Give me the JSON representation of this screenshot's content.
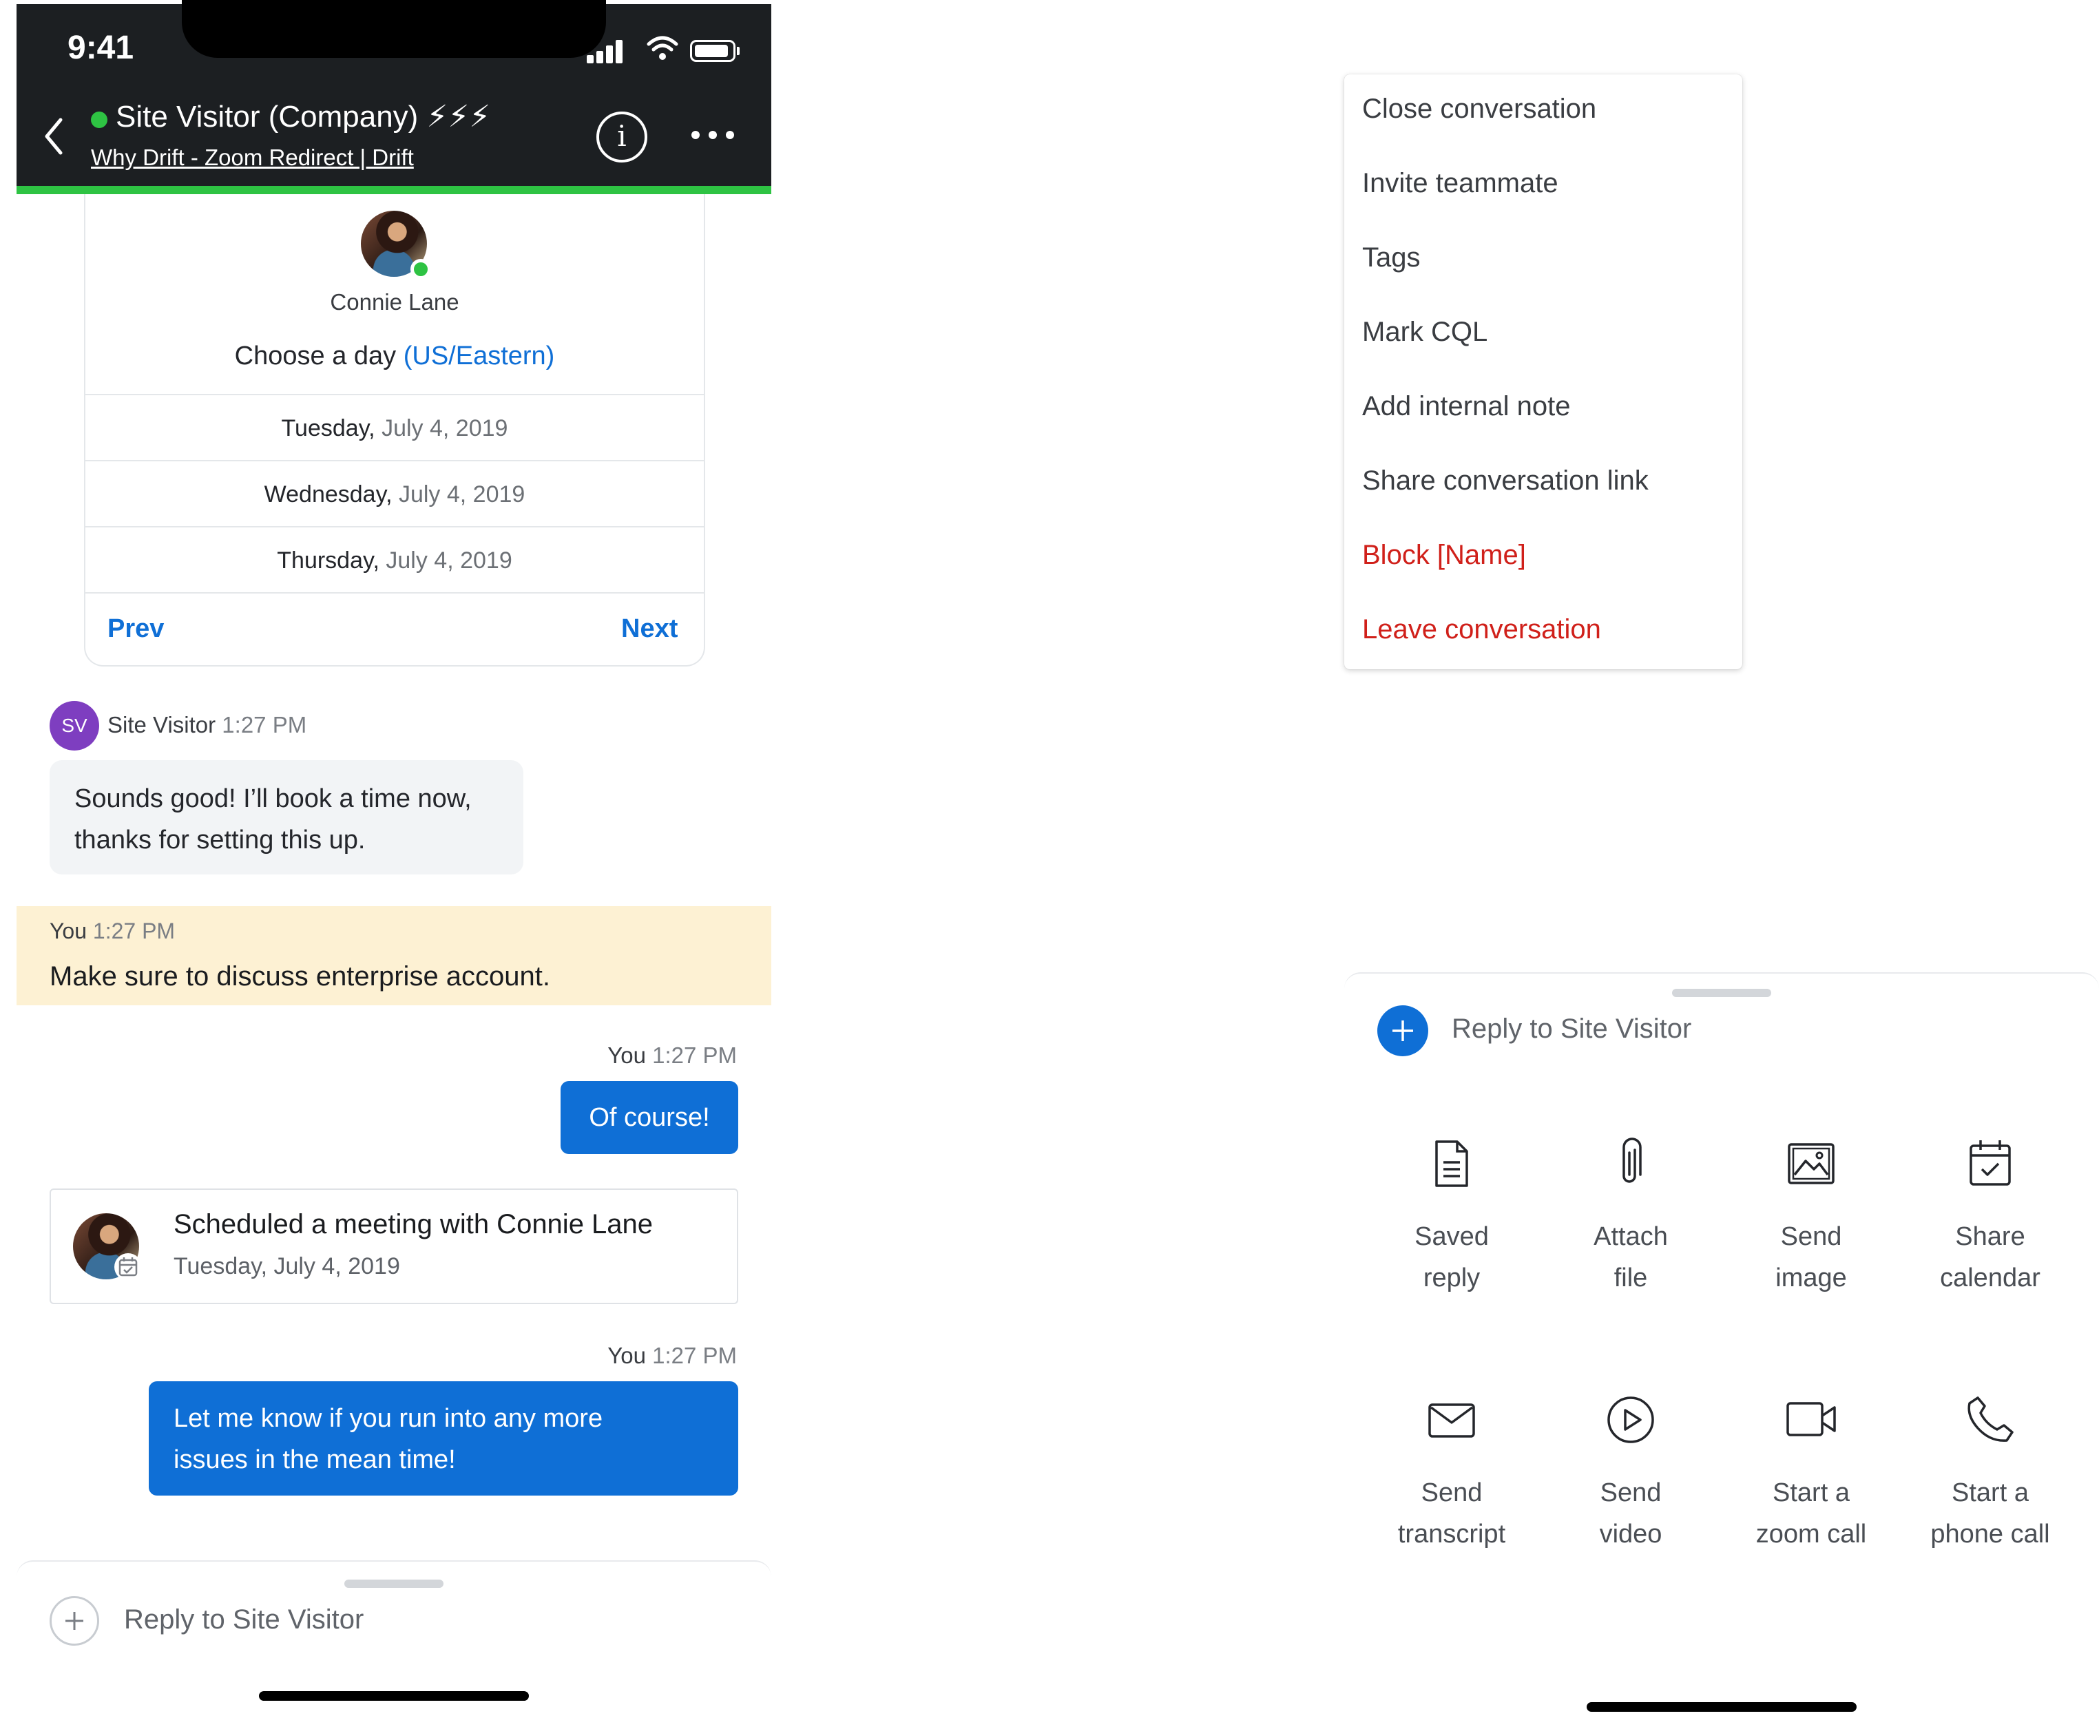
{
  "status_bar": {
    "time": "9:41"
  },
  "header": {
    "title": "Site Visitor (Company) ⚡⚡⚡",
    "subtitle": "Why Drift - Zoom Redirect | Drift"
  },
  "scheduler": {
    "agent_name": "Connie Lane",
    "choose_label": "Choose a day",
    "timezone": "(US/Eastern)",
    "days": [
      {
        "weekday": "Tuesday,",
        "date": "July 4, 2019"
      },
      {
        "weekday": "Wednesday,",
        "date": "July 4, 2019"
      },
      {
        "weekday": "Thursday,",
        "date": "July 4, 2019"
      }
    ],
    "prev_label": "Prev",
    "next_label": "Next"
  },
  "messages": {
    "visitor": {
      "initials": "SV",
      "name": "Site Visitor",
      "time": "1:27 PM",
      "text_line1": "Sounds good! I’ll book a time now,",
      "text_line2": "thanks for setting this up."
    },
    "note": {
      "author": "You",
      "time": "1:27 PM",
      "text": "Make sure to discuss enterprise account."
    },
    "reply1": {
      "author": "You",
      "time": "1:27 PM",
      "text": "Of course!"
    },
    "meeting": {
      "title": "Scheduled a meeting with Connie Lane",
      "date": "Tuesday, July 4, 2019"
    },
    "reply2": {
      "author": "You",
      "time": "1:27 PM",
      "text_line1": "Let me know if you run into any more",
      "text_line2": "issues in the mean time!"
    }
  },
  "composer": {
    "placeholder": "Reply to Site Visitor"
  },
  "menu": {
    "items": [
      "Close conversation",
      "Invite teammate",
      "Tags",
      "Mark CQL",
      "Add internal note",
      "Share conversation link",
      "Block [Name]",
      "Leave conversation"
    ]
  },
  "actions": [
    {
      "icon": "document-icon",
      "line1": "Saved",
      "line2": "reply"
    },
    {
      "icon": "paperclip-icon",
      "line1": "Attach",
      "line2": "file"
    },
    {
      "icon": "image-icon",
      "line1": "Send",
      "line2": "image"
    },
    {
      "icon": "calendar-icon",
      "line1": "Share",
      "line2": "calendar"
    },
    {
      "icon": "envelope-icon",
      "line1": "Send",
      "line2": "transcript"
    },
    {
      "icon": "play-icon",
      "line1": "Send",
      "line2": "video"
    },
    {
      "icon": "video-camera-icon",
      "line1": "Start a",
      "line2": "zoom call"
    },
    {
      "icon": "phone-icon",
      "line1": "Start a",
      "line2": "phone call"
    }
  ],
  "colors": {
    "accent_blue": "#0f6fd6",
    "online_green": "#2ec343",
    "danger_red": "#d0201a",
    "note_yellow": "#fdf1d3",
    "header_dark": "#1c1f22"
  }
}
